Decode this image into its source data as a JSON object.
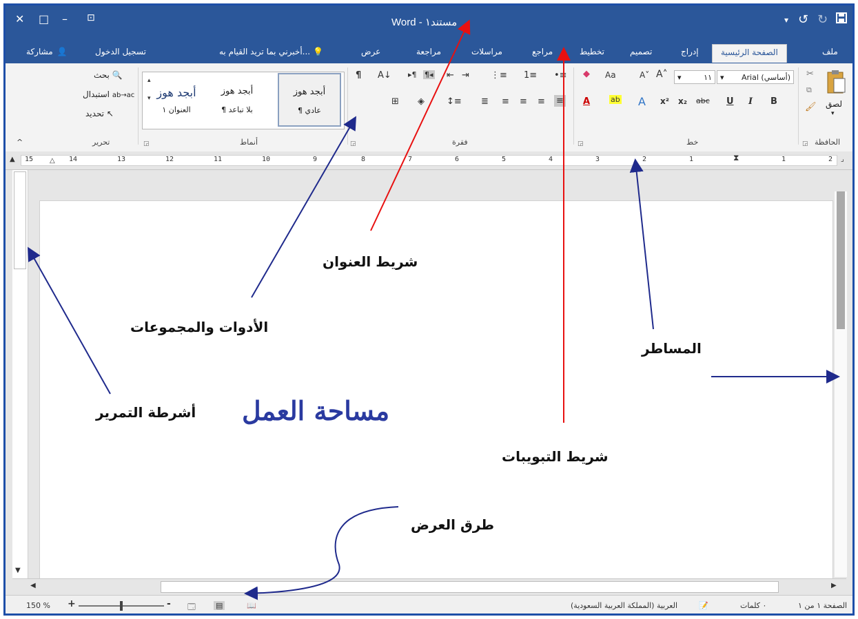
{
  "titlebar": {
    "title": "Word - مستند١",
    "close": "✕",
    "restore": "□",
    "minimize": "–",
    "ribbon_display": "⊡",
    "save": "💾",
    "undo": "↺",
    "redo": "↻",
    "qat_more": "▾"
  },
  "tabs": {
    "file": "ملف",
    "home": "الصفحة الرئيسية",
    "insert": "إدراج",
    "design": "تصميم",
    "layout": "تخطيط",
    "references": "مراجع",
    "mailings": "مراسلات",
    "review": "مراجعة",
    "view": "عرض",
    "tell_me": "أخبرني بما تريد القيام به...",
    "sign_in": "تسجيل الدخول",
    "share": "مشاركة"
  },
  "ribbon": {
    "clipboard": {
      "label": "الحافظة",
      "paste": "لصق"
    },
    "font": {
      "label": "خط",
      "font_name": "Arial (أساسي)",
      "font_size": "١١",
      "grow": "A˄",
      "shrink": "A˅",
      "change_case": "Aa",
      "bold": "B",
      "italic": "I",
      "underline": "U",
      "strike": "abc",
      "subscript": "x₂",
      "superscript": "x²"
    },
    "paragraph": {
      "label": "فقرة",
      "show_marks": "¶"
    },
    "styles": {
      "label": "أنماط",
      "items": [
        {
          "preview": "أبجد هوز",
          "name": "¶ عادي"
        },
        {
          "preview": "أبجد هوز",
          "name": "¶ بلا تباعد"
        },
        {
          "preview": "أبجد هوز",
          "name": "العنوان ١"
        }
      ]
    },
    "editing": {
      "label": "تحرير",
      "find": "بحث",
      "replace": "استبدال",
      "select": "تحديد"
    }
  },
  "ruler": {
    "numbers": [
      "15",
      "14",
      "13",
      "12",
      "11",
      "10",
      "9",
      "8",
      "7",
      "6",
      "5",
      "4",
      "3",
      "2",
      "1",
      "1",
      "2"
    ]
  },
  "annotations": {
    "title_bar": "شريط العنوان",
    "tools_groups": "الأدوات والمجموعات",
    "rulers": "المساطر",
    "scrollbars": "أشرطة التمرير",
    "work_area": "مساحة العمل",
    "tabs_bar": "شريط التبويبات",
    "view_modes": "طرق العرض"
  },
  "status": {
    "page": "الصفحة ١ من ١",
    "words": "٠ كلمات",
    "language": "العربية (المملكة العربية السعودية)",
    "zoom": "150 %",
    "zoom_plus": "+",
    "zoom_minus": "-"
  },
  "colors": {
    "word_blue": "#2b579a",
    "annotation_blue": "#1f2a8c",
    "annotation_red": "#e81010",
    "work_area_text": "#2a3aa0"
  }
}
